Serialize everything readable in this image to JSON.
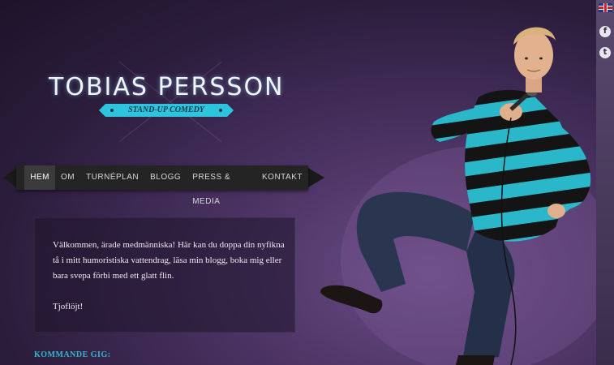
{
  "site": {
    "title": "TOBIAS PERSSON",
    "tagline": "STAND-UP COMEDY"
  },
  "nav": {
    "items": [
      "HEM",
      "OM",
      "TURNÉPLAN",
      "BLOGG",
      "PRESS & MEDIA",
      "KONTAKT"
    ],
    "active": "HEM"
  },
  "welcome": {
    "text": "Välkommen, ärade medmänniska! Här kan du doppa din nyfikna tå i mitt humoristiska vattendrag, läsa min blogg, boka mig eller bara svepa förbi med ett glatt flin.",
    "signoff": "Tjoflöjt!"
  },
  "upcoming": {
    "heading": "KOMMANDE GIG:"
  },
  "sidebar": {
    "icons": [
      "uk-flag-icon",
      "facebook-icon",
      "twitter-icon"
    ],
    "facebook_glyph": "f",
    "twitter_glyph": "t"
  },
  "colors": {
    "accent": "#2fc4dd",
    "background": "#2c1d3d",
    "nav": "#242424"
  }
}
